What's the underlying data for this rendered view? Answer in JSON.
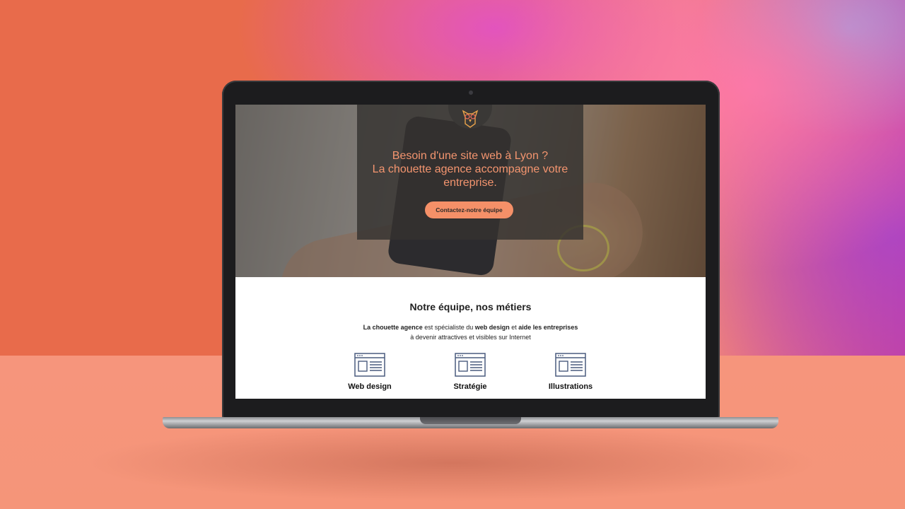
{
  "hero": {
    "title_line1": "Besoin d'une site web à Lyon ?",
    "title_line2": "La chouette agence accompagne votre",
    "title_line3": "entreprise.",
    "cta_label": "Contactez-notre équipe"
  },
  "section": {
    "title": "Notre équipe, nos métiers",
    "desc_part1": "La chouette agence",
    "desc_part2": " est spécialiste du ",
    "desc_part3": "web design",
    "desc_part4": " et ",
    "desc_part5": "aide les entreprises",
    "desc_line2": "à devenir attractives et visibles sur Internet"
  },
  "services": [
    {
      "label": "Web design",
      "icon": "browser-window-icon"
    },
    {
      "label": "Stratégie",
      "icon": "browser-window-icon"
    },
    {
      "label": "Illustrations",
      "icon": "browser-window-icon"
    }
  ],
  "colors": {
    "accent": "#f59068",
    "hero_text": "#f4956f",
    "icon_stroke": "#4a5b7e",
    "background": "#e9704c"
  }
}
